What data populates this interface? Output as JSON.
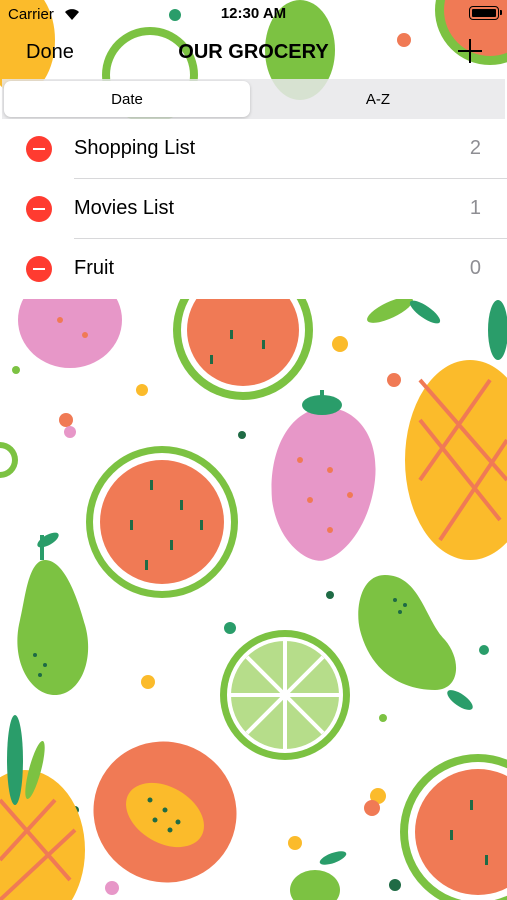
{
  "status": {
    "carrier": "Carrier",
    "time": "12:30 AM"
  },
  "nav": {
    "done_label": "Done",
    "title": "OUR GROCERY"
  },
  "segments": [
    "Date",
    "A-Z"
  ],
  "lists": [
    {
      "name": "Shopping List",
      "count": "2"
    },
    {
      "name": "Movies List",
      "count": "1"
    },
    {
      "name": "Fruit",
      "count": "0"
    }
  ],
  "colors": {
    "delete": "#ff3b30",
    "count_text": "#8e8e93",
    "fruit_green": "#7cc242",
    "fruit_orange": "#f07a55",
    "fruit_pink": "#e797c8",
    "fruit_yellow": "#fbbb2b"
  }
}
